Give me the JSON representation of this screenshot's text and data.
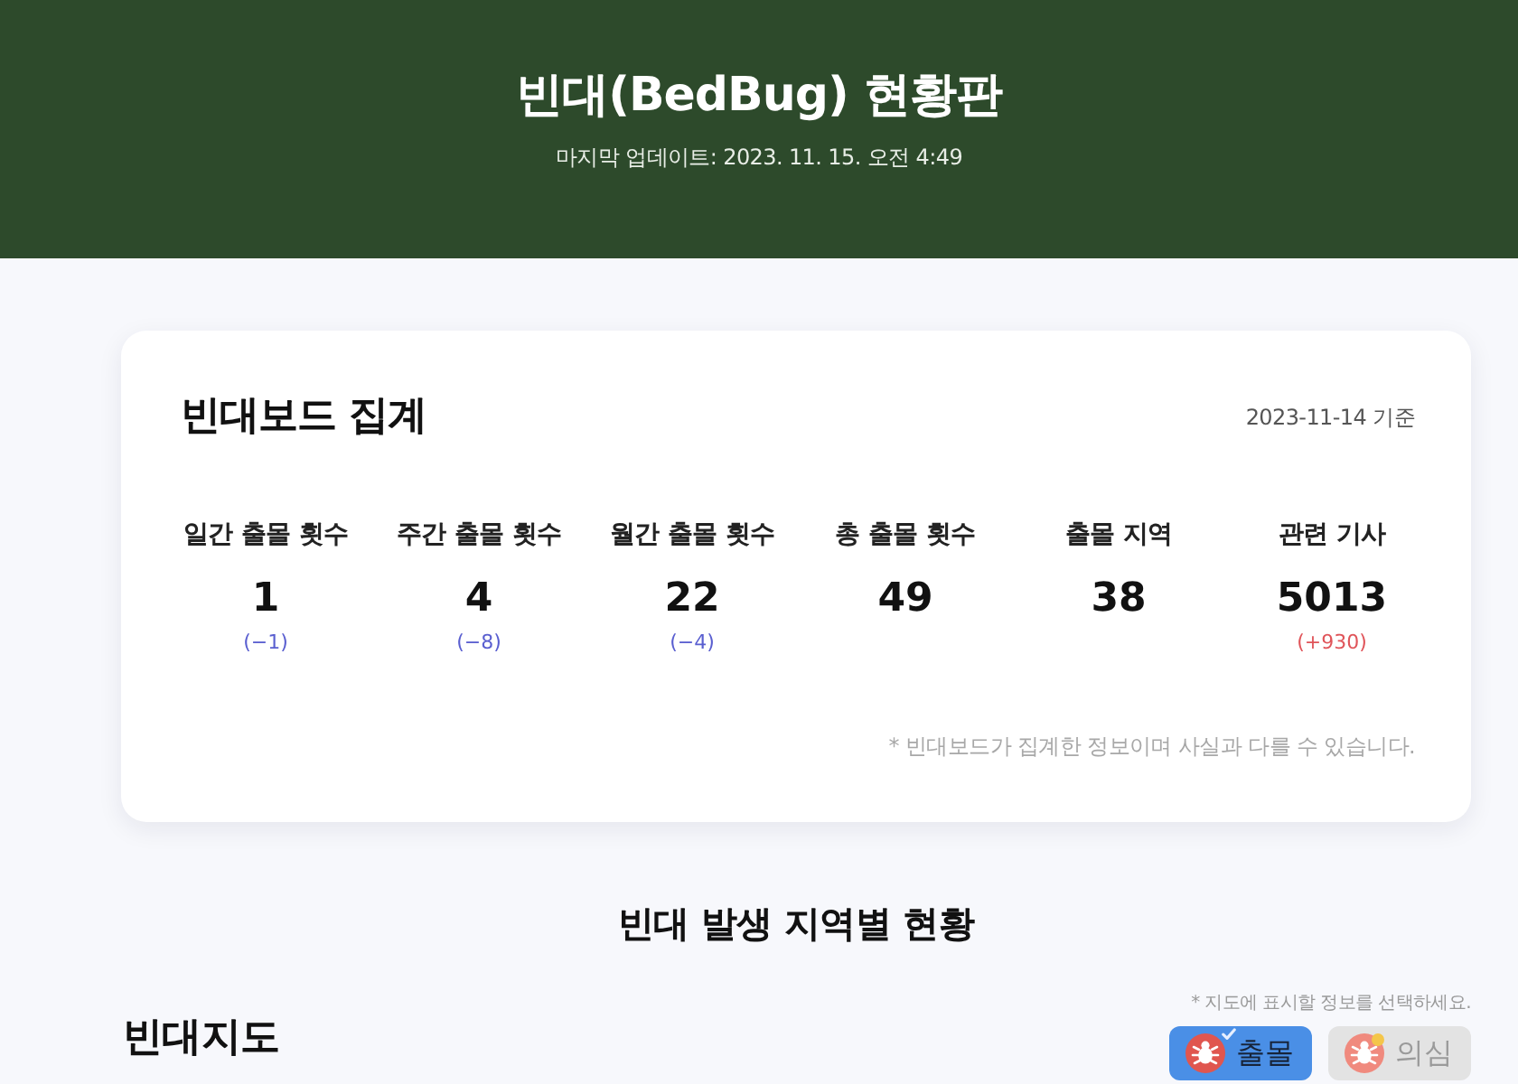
{
  "header": {
    "title": "빈대(BedBug) 현황판",
    "updated": "마지막 업데이트: 2023. 11. 15. 오전 4:49"
  },
  "summary": {
    "title": "빈대보드 집계",
    "as_of": "2023-11-14 기준",
    "stats": [
      {
        "label": "일간 출몰 횟수",
        "value": "1",
        "change": {
          "text": "(−1)",
          "color": "#5a5fd0"
        }
      },
      {
        "label": "주간 출몰 횟수",
        "value": "4",
        "change": {
          "text": "(−8)",
          "color": "#5a5fd0"
        }
      },
      {
        "label": "월간 출몰 횟수",
        "value": "22",
        "change": {
          "text": "(−4)",
          "color": "#5a5fd0"
        }
      },
      {
        "label": "총 출몰 횟수",
        "value": "49"
      },
      {
        "label": "출몰 지역",
        "value": "38"
      },
      {
        "label": "관련 기사",
        "value": "5013",
        "change": {
          "text": "(+930)",
          "color": "#e0555a"
        }
      }
    ],
    "note": "* 빈대보드가 집계한 정보이며 사실과 다를 수 있습니다."
  },
  "section_title": "빈대 발생 지역별 현황",
  "map": {
    "title": "빈대지도",
    "hint": "* 지도에 표시할 정보를 선택하세요.",
    "toggles": [
      {
        "kind": "sighting",
        "label": "출몰",
        "selected": true
      },
      {
        "kind": "suspect",
        "label": "의심",
        "selected": false
      }
    ]
  }
}
